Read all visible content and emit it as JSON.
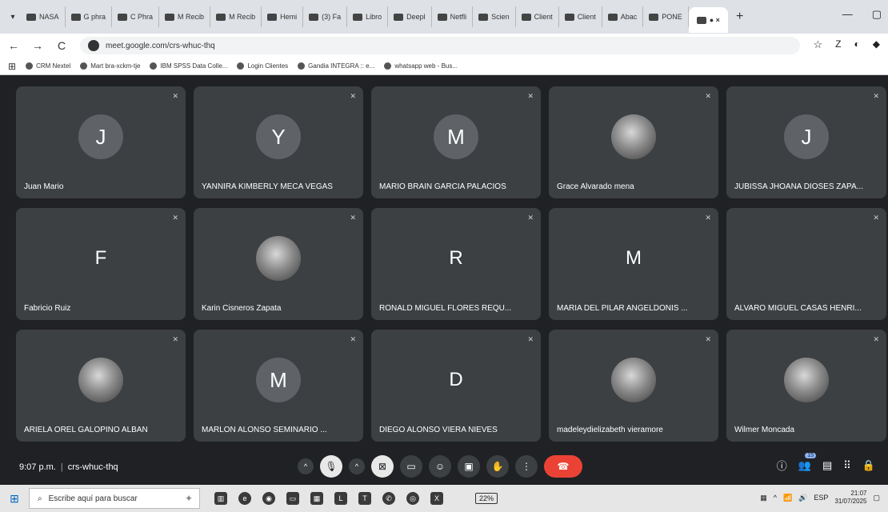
{
  "browser": {
    "tabs": [
      {
        "icon": "nasa-favicon",
        "label": "NASA"
      },
      {
        "icon": "google-favicon",
        "label": "G phra"
      },
      {
        "icon": "google-favicon",
        "label": "C Phra"
      },
      {
        "icon": "gmail-favicon",
        "label": "M Recib"
      },
      {
        "icon": "gmail-favicon",
        "label": "M Recib"
      },
      {
        "icon": "globe-favicon",
        "label": "Hemi"
      },
      {
        "icon": "facebook-favicon",
        "label": "(3) Fa"
      },
      {
        "icon": "globe-favicon",
        "label": "Libro"
      },
      {
        "icon": "deepl-favicon",
        "label": "Deepl"
      },
      {
        "icon": "netflix-favicon",
        "label": "Netfli"
      },
      {
        "icon": "doc-favicon",
        "label": "Scien"
      },
      {
        "icon": "doc-favicon",
        "label": "Client"
      },
      {
        "icon": "doc-favicon",
        "label": "Client"
      },
      {
        "icon": "abacus-favicon",
        "label": "Abac"
      },
      {
        "icon": "doc-favicon",
        "label": "PONE"
      }
    ],
    "active_tab": {
      "label": "● ×"
    },
    "url": "meet.google.com/crs-whuc-thq",
    "profile_letter": "Z",
    "bookmarks": [
      {
        "label": "CRM Nextel"
      },
      {
        "label": "Mart bra-xckm-tje"
      },
      {
        "label": "IBM SPSS Data Colle..."
      },
      {
        "label": "Login Clientes"
      },
      {
        "label": "Gandia INTEGRA :: e..."
      },
      {
        "label": "whatsapp web - Bus..."
      }
    ]
  },
  "meet": {
    "participants": [
      {
        "name": "Juan Mario",
        "avatar_type": "letter",
        "initial": "J"
      },
      {
        "name": "YANNIRA KIMBERLY MECA VEGAS",
        "avatar_type": "letter",
        "initial": "Y"
      },
      {
        "name": "MARIO BRAIN GARCIA PALACIOS",
        "avatar_type": "letter",
        "initial": "M"
      },
      {
        "name": "Grace Alvarado mena",
        "avatar_type": "photo",
        "initial": ""
      },
      {
        "name": "JUBISSA JHOANA DIOSES ZAPA...",
        "avatar_type": "letter",
        "initial": "J"
      },
      {
        "name": "Fabricio Ruiz",
        "avatar_type": "plain",
        "initial": "F"
      },
      {
        "name": "Karin Cisneros Zapata",
        "avatar_type": "photo",
        "initial": ""
      },
      {
        "name": "RONALD MIGUEL FLORES REQU...",
        "avatar_type": "plain",
        "initial": "R"
      },
      {
        "name": "MARIA DEL PILAR ANGELDONIS ...",
        "avatar_type": "plain",
        "initial": "M"
      },
      {
        "name": "ALVARO MIGUEL CASAS HENRI...",
        "avatar_type": "none",
        "initial": ""
      },
      {
        "name": "ARIELA OREL GALOPINO ALBAN",
        "avatar_type": "photo",
        "initial": ""
      },
      {
        "name": "MARLON ALONSO SEMINARIO ...",
        "avatar_type": "letter",
        "initial": "M"
      },
      {
        "name": "DIEGO ALONSO VIERA NIEVES",
        "avatar_type": "plain",
        "initial": "D"
      },
      {
        "name": "madeleydielizabeth vieramore",
        "avatar_type": "photo",
        "initial": ""
      },
      {
        "name": "Wilmer Moncada",
        "avatar_type": "photo",
        "initial": ""
      }
    ],
    "time": "9:07 p.m.",
    "meeting_code": "crs-whuc-thq",
    "participants_count": "15",
    "controls": [
      {
        "name": "more-audio-options",
        "glyph": "^"
      },
      {
        "name": "mic-off",
        "glyph": "🎙"
      },
      {
        "name": "more-video-options",
        "glyph": "^"
      },
      {
        "name": "camera-off",
        "glyph": "⊠"
      },
      {
        "name": "captions",
        "glyph": "▭"
      },
      {
        "name": "emoji",
        "glyph": "☺"
      },
      {
        "name": "present",
        "glyph": "▣"
      },
      {
        "name": "raise-hand",
        "glyph": "✋"
      },
      {
        "name": "more-options",
        "glyph": "⋮"
      },
      {
        "name": "leave-call",
        "glyph": "☎"
      }
    ]
  },
  "taskbar": {
    "search_placeholder": "Escribe aquí para buscar",
    "battery": "22%",
    "lang": "ESP",
    "time": "21:07",
    "date": "31/07/2025"
  }
}
